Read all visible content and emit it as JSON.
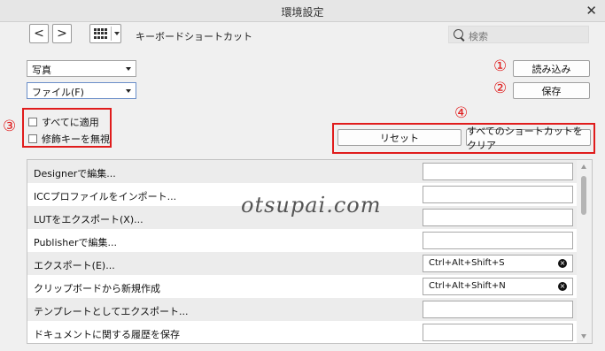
{
  "window": {
    "title": "環境設定",
    "close_glyph": "✕"
  },
  "toolbar": {
    "back": "<",
    "forward": ">",
    "breadcrumb": "キーボードショートカット",
    "search_placeholder": "検索"
  },
  "dropdowns": {
    "persona": "写真",
    "category": "ファイル(F)"
  },
  "buttons": {
    "import": "読み込み",
    "save": "保存",
    "reset": "リセット",
    "clear_all": "すべてのショートカットをクリア"
  },
  "checkboxes": [
    {
      "label": "すべてに適用",
      "checked": false
    },
    {
      "label": "修飾キーを無視",
      "checked": false
    }
  ],
  "annotations": {
    "n1": "①",
    "n2": "②",
    "n3": "③",
    "n4": "④",
    "accent_color": "#e01c1c"
  },
  "shortcuts": [
    {
      "label": "Designerで編集...",
      "shortcut": ""
    },
    {
      "label": "ICCプロファイルをインポート...",
      "shortcut": ""
    },
    {
      "label": "LUTをエクスポート(X)...",
      "shortcut": ""
    },
    {
      "label": "Publisherで編集...",
      "shortcut": ""
    },
    {
      "label": "エクスポート(E)...",
      "shortcut": "Ctrl+Alt+Shift+S"
    },
    {
      "label": "クリップボードから新規作成",
      "shortcut": "Ctrl+Alt+Shift+N"
    },
    {
      "label": "テンプレートとしてエクスポート...",
      "shortcut": ""
    },
    {
      "label": "ドキュメントに関する履歴を保存",
      "shortcut": ""
    }
  ],
  "watermark": "otsupai.com"
}
